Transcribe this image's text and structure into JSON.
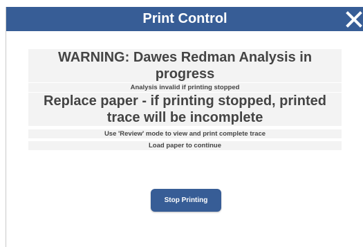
{
  "dialog": {
    "title": "Print Control",
    "close_icon": "close-icon",
    "colors": {
      "header": "#375d96",
      "button": "#375d96",
      "band": "#f3f3f3",
      "text": "#444444"
    }
  },
  "messages": {
    "warning": "WARNING: Dawes Redman Analysis in progress",
    "analysis_note": "Analysis invalid if printing stopped",
    "replace_paper": "Replace paper - if printing stopped, printed trace will be incomplete",
    "review_hint": "Use 'Review' mode to view and print complete trace",
    "load_paper": "Load paper to continue"
  },
  "actions": {
    "stop_label": "Stop Printing"
  }
}
